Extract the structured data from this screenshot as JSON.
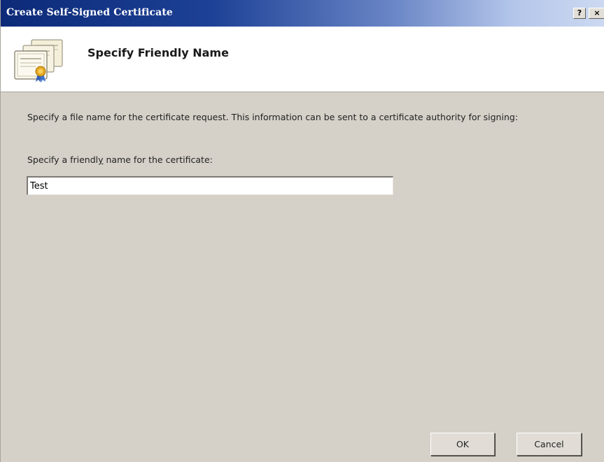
{
  "window": {
    "title": "Create Self-Signed Certificate",
    "help_label": "?",
    "close_label": "×"
  },
  "header": {
    "title": "Specify Friendly Name",
    "icon": "certificate-icon"
  },
  "body": {
    "description": "Specify a file name for the certificate request.  This information can be sent to a certificate authority for signing:",
    "friendly_label_pre": "Specify a friendl",
    "friendly_label_accel": "y",
    "friendly_label_post": " name for the certificate:",
    "friendly_name_value": "Test"
  },
  "buttons": {
    "ok": "OK",
    "cancel": "Cancel"
  }
}
